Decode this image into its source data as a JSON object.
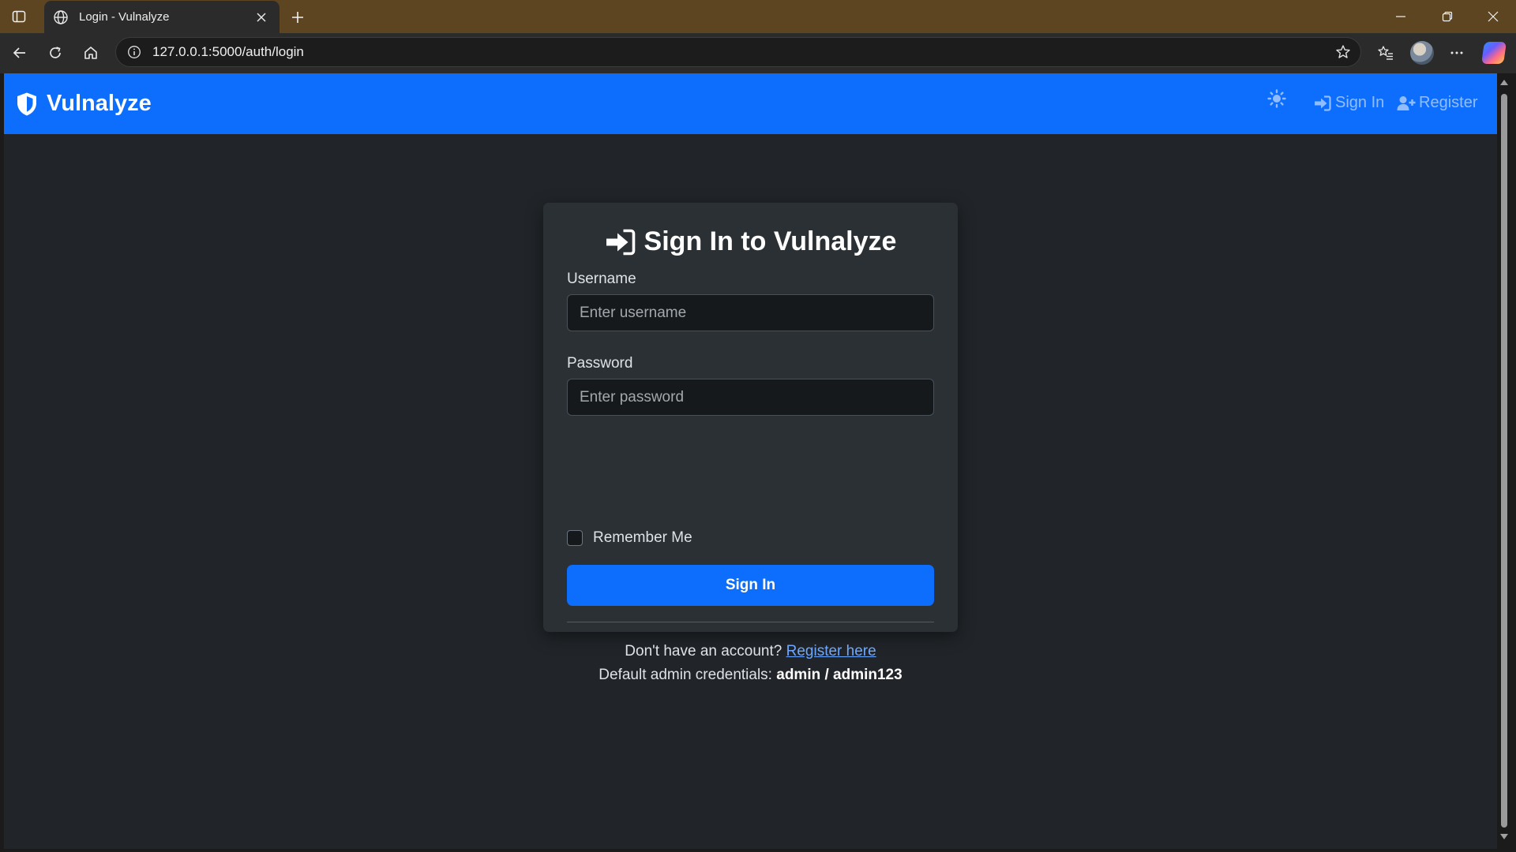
{
  "browser": {
    "tab": {
      "title": "Login - Vulnalyze",
      "favicon_icon": "globe-icon"
    },
    "address_bar": {
      "url": "127.0.0.1:5000/auth/login"
    },
    "colors": {
      "frame": "#5c4520",
      "toolbar": "#2b2b2b"
    }
  },
  "navbar": {
    "brand": "Vulnalyze",
    "brand_icon": "shield-icon",
    "theme_icon": "sun-icon",
    "links": [
      {
        "label": "Sign In",
        "icon": "sign-in-icon"
      },
      {
        "label": "Register",
        "icon": "user-plus-icon"
      }
    ],
    "color": "#0d6efd"
  },
  "login_card": {
    "title": "Sign In to Vulnalyze",
    "title_icon": "sign-in-icon",
    "username": {
      "label": "Username",
      "placeholder": "Enter username",
      "value": ""
    },
    "password": {
      "label": "Password",
      "placeholder": "Enter password",
      "value": ""
    },
    "remember_me": {
      "label": "Remember Me",
      "checked": false
    },
    "submit_label": "Sign In",
    "footer": {
      "register_prompt": "Don't have an account?",
      "register_link": "Register here",
      "creds_prompt": "Default admin credentials:",
      "creds_value": "admin / admin123"
    },
    "colors": {
      "background": "#212529",
      "card": "#2b3035",
      "primary": "#0d6efd",
      "link": "#6ea8fe"
    }
  }
}
